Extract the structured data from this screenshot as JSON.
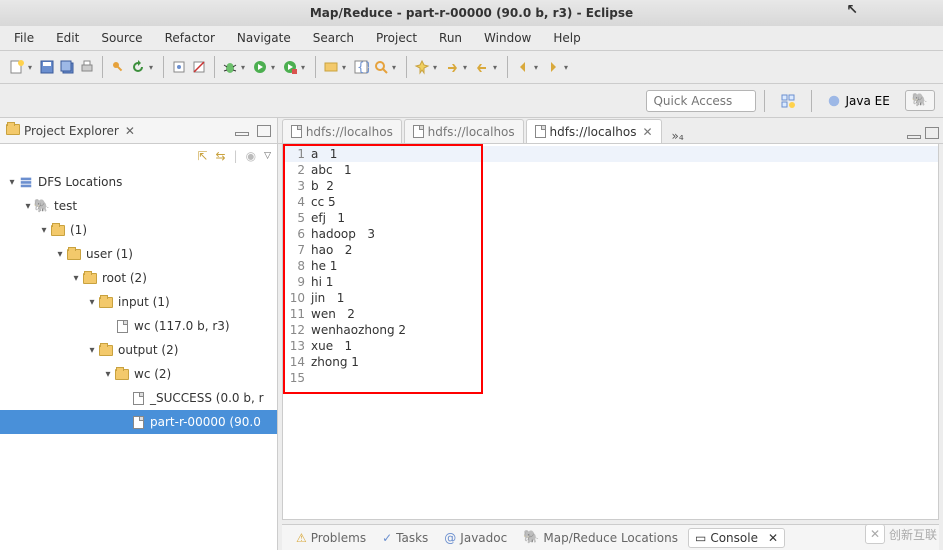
{
  "title": "Map/Reduce - part-r-00000 (90.0 b, r3) - Eclipse",
  "menu": [
    "File",
    "Edit",
    "Source",
    "Refactor",
    "Navigate",
    "Search",
    "Project",
    "Run",
    "Window",
    "Help"
  ],
  "quick_access_placeholder": "Quick Access",
  "perspective_open_icon": "open-perspective",
  "perspectives": [
    {
      "label": "Java EE",
      "icon": "javaee"
    },
    {
      "label": "",
      "icon": "mapreduce"
    }
  ],
  "left_view": {
    "title": "Project Explorer",
    "tree": [
      {
        "depth": 0,
        "twist": "down",
        "icon": "dfs",
        "label": "DFS Locations"
      },
      {
        "depth": 1,
        "twist": "down",
        "icon": "elephant",
        "label": "test"
      },
      {
        "depth": 2,
        "twist": "down",
        "icon": "folder",
        "label": "(1)"
      },
      {
        "depth": 3,
        "twist": "down",
        "icon": "folder",
        "label": "user (1)"
      },
      {
        "depth": 4,
        "twist": "down",
        "icon": "folder",
        "label": "root (2)"
      },
      {
        "depth": 5,
        "twist": "down",
        "icon": "folder",
        "label": "input (1)"
      },
      {
        "depth": 6,
        "twist": "",
        "icon": "file",
        "label": "wc (117.0 b, r3)"
      },
      {
        "depth": 5,
        "twist": "down",
        "icon": "folder",
        "label": "output (2)"
      },
      {
        "depth": 6,
        "twist": "down",
        "icon": "folder",
        "label": "wc (2)"
      },
      {
        "depth": 7,
        "twist": "",
        "icon": "file",
        "label": "_SUCCESS (0.0 b, r"
      },
      {
        "depth": 7,
        "twist": "",
        "icon": "file",
        "label": "part-r-00000 (90.0",
        "sel": true
      }
    ]
  },
  "editor_tabs": [
    {
      "label": "hdfs://localhos",
      "active": false
    },
    {
      "label": "hdfs://localhos",
      "active": false
    },
    {
      "label": "hdfs://localhos",
      "active": true
    }
  ],
  "editor_more": "»₄",
  "editor_lines": [
    {
      "n": 1,
      "t": "a   1",
      "hl": true
    },
    {
      "n": 2,
      "t": "abc   1"
    },
    {
      "n": 3,
      "t": "b  2"
    },
    {
      "n": 4,
      "t": "cc 5"
    },
    {
      "n": 5,
      "t": "efj   1"
    },
    {
      "n": 6,
      "t": "hadoop   3"
    },
    {
      "n": 7,
      "t": "hao   2"
    },
    {
      "n": 8,
      "t": "he 1"
    },
    {
      "n": 9,
      "t": "hi 1"
    },
    {
      "n": 10,
      "t": "jin   1"
    },
    {
      "n": 11,
      "t": "wen   2"
    },
    {
      "n": 12,
      "t": "wenhaozhong 2"
    },
    {
      "n": 13,
      "t": "xue   1"
    },
    {
      "n": 14,
      "t": "zhong 1"
    },
    {
      "n": 15,
      "t": ""
    }
  ],
  "bottom_tabs": [
    {
      "label": "Problems",
      "icon": "problems"
    },
    {
      "label": "Tasks",
      "icon": "tasks"
    },
    {
      "label": "Javadoc",
      "icon": "javadoc"
    },
    {
      "label": "Map/Reduce Locations",
      "icon": "mapreduce"
    },
    {
      "label": "Console",
      "icon": "console",
      "active": true
    }
  ],
  "watermark": "创新互联"
}
